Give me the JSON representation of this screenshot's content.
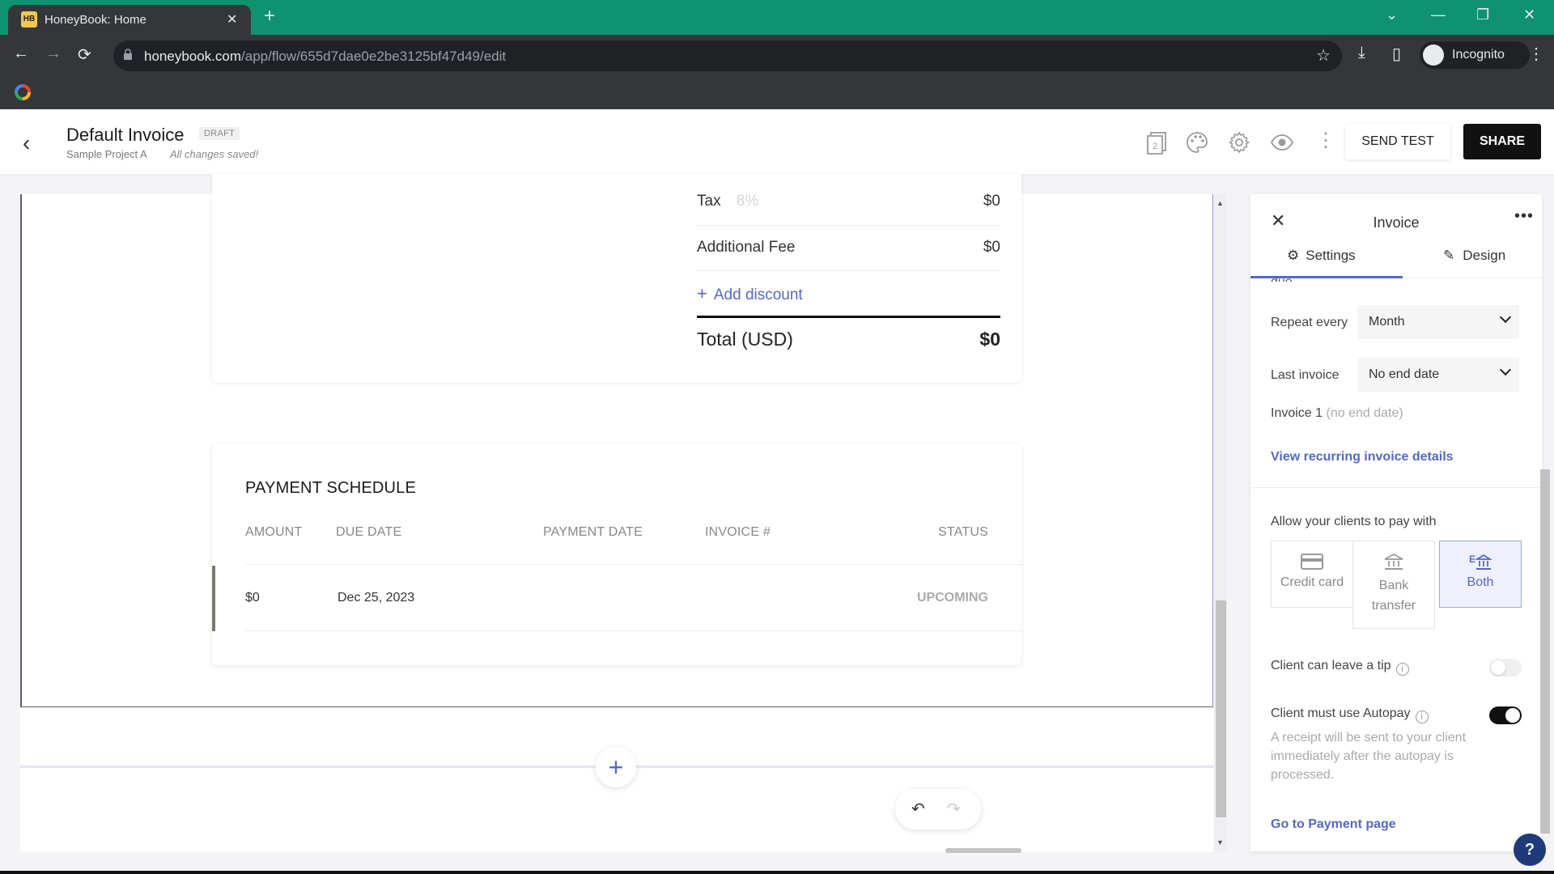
{
  "browser": {
    "tab_title": "HoneyBook: Home",
    "tab_favicon": "HB",
    "url_domain": "honeybook.com",
    "url_path": "/app/flow/655d7dae0e2be3125bf47d49/edit",
    "profile_label": "Incognito",
    "icons": {
      "back": "←",
      "forward": "→",
      "reload": "⟳",
      "star": "☆",
      "download": "⤓",
      "sidepanel": "▯",
      "menu": "⋮",
      "newtab": "+",
      "close": "✕",
      "win_dropdown": "⌄",
      "win_min": "—",
      "win_max": "❐",
      "win_close": "✕"
    }
  },
  "header": {
    "back_icon": "‹",
    "title": "Default Invoice",
    "badge": "DRAFT",
    "project": "Sample Project A",
    "save_status": "All changes saved!",
    "pages_count": "2",
    "more_icon": "⋮",
    "send_test_label": "SEND TEST",
    "share_label": "SHARE"
  },
  "totals": {
    "rows": [
      {
        "label": "Tax",
        "rate": "8%",
        "amount": "$0"
      },
      {
        "label": "Additional Fee",
        "amount": "$0"
      }
    ],
    "add_discount_label": "Add discount",
    "add_icon": "+",
    "total_label": "Total (USD)",
    "total_amount": "$0"
  },
  "payment_schedule": {
    "title": "PAYMENT SCHEDULE",
    "columns": [
      "AMOUNT",
      "DUE DATE",
      "PAYMENT DATE",
      "INVOICE #",
      "STATUS"
    ],
    "rows": [
      {
        "amount": "$0",
        "due_date": "Dec 25, 2023",
        "payment_date": "",
        "invoice_no": "",
        "status": "UPCOMING"
      }
    ]
  },
  "canvas": {
    "add_block_icon": "+",
    "undo_icon": "↶",
    "redo_icon": "↷",
    "scroll_up": "▲",
    "scroll_down": "▼"
  },
  "panel": {
    "close_icon": "✕",
    "title": "Invoice",
    "more_icon": "•••",
    "tabs": [
      {
        "label": "Settings",
        "icon": "⚙",
        "active": true
      },
      {
        "label": "Design",
        "icon": "✎",
        "active": false
      }
    ],
    "due_partial": "due",
    "repeat_every_label": "Repeat every",
    "repeat_every_value": "Month",
    "last_invoice_label": "Last invoice",
    "last_invoice_value": "No end date",
    "invoice_count": "Invoice 1",
    "invoice_count_note": "(no end date)",
    "view_recurring_label": "View recurring invoice details",
    "pay_with_label": "Allow your clients to pay with",
    "pay_options": [
      {
        "label": "Credit card",
        "selected": false
      },
      {
        "label": "Bank transfer",
        "selected": false
      },
      {
        "label": "Both",
        "selected": true
      }
    ],
    "tip_label": "Client can leave a tip",
    "tip_enabled": false,
    "autopay_label": "Client must use Autopay",
    "autopay_enabled": true,
    "info_icon": "i",
    "autopay_note": "A receipt will be sent to your client immediately after the autopay is processed.",
    "go_payment_label": "Go to Payment page",
    "help_label": "?"
  },
  "colors": {
    "accent": "#5468c7",
    "browser_tabbar": "#0f9270",
    "share_bg": "#111111",
    "help_bg": "#1f3a7a"
  }
}
